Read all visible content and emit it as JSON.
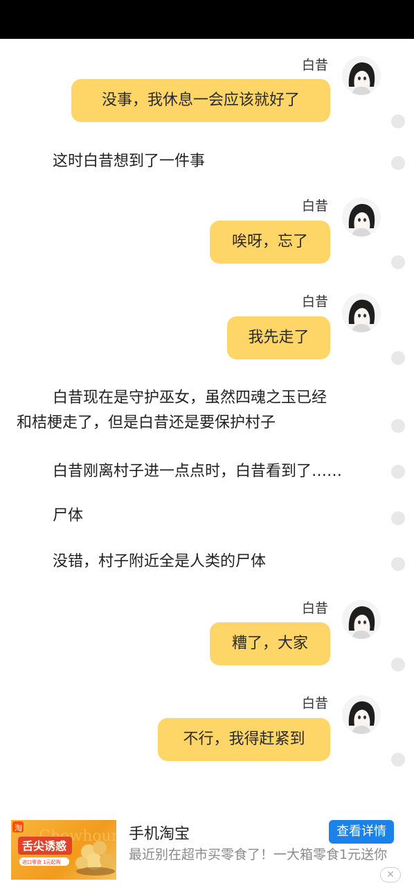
{
  "messages": [
    {
      "speaker": "白昔",
      "text": "没事，我休息一会应该就好了"
    },
    {
      "narration": "这时白昔想到了一件事"
    },
    {
      "speaker": "白昔",
      "text": "唉呀，忘了"
    },
    {
      "speaker": "白昔",
      "text": "我先走了"
    },
    {
      "narration_lines": [
        "白昔现在是守护巫女，虽然四魂之玉已经",
        "和桔梗走了，但是白昔还是要保护村子"
      ]
    },
    {
      "narration": "白昔刚离村子进一点点时，白昔看到了……"
    },
    {
      "narration": "尸体"
    },
    {
      "narration": "没错，村子附近全是人类的尸体"
    },
    {
      "speaker": "白昔",
      "text": "糟了，大家"
    },
    {
      "speaker": "白昔",
      "text": "不行，我得赶紧到"
    }
  ],
  "ad": {
    "title": "手机淘宝",
    "description": "最近别在超市买零食了！一大箱零食1元送你",
    "button_label": "查看详情",
    "close_label": "✕",
    "image": {
      "brand_text": "淘",
      "watermark": "Chowhound",
      "headline": "舌尖诱惑",
      "caption": "进口零食 1元起购"
    }
  },
  "colors": {
    "bubble": "#fed567",
    "status_bar": "#000000",
    "ad_button": "#1a82e8"
  },
  "icons": {
    "avatar": "anime-girl-avatar-icon",
    "read_indicator": "gray-dot-icon",
    "close": "close-icon"
  }
}
